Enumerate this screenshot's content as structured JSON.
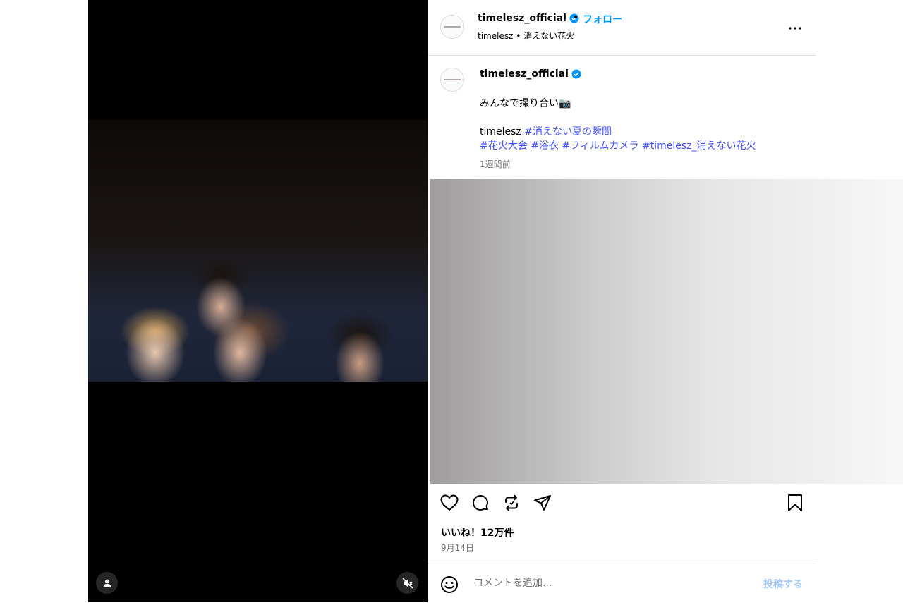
{
  "post": {
    "username": "timelesz_official",
    "follow_label": "フォロー",
    "separator": "•",
    "subline": "timelesz • 消えない花火"
  },
  "caption": {
    "username": "timelesz_official",
    "line1": "みんなで撮り合い📷",
    "author_tag": "timelesz",
    "tag1": "#消えない夏の瞬間",
    "tag2": "#花火大会",
    "tag3": "#浴衣",
    "tag4": "#フィルムカメラ",
    "tag5": "#timelesz_消えない花火",
    "time_ago": "1週間前"
  },
  "engagement": {
    "likes": "いいね！12万件",
    "date": "9月14日"
  },
  "comment": {
    "placeholder": "コメントを追加...",
    "post_label": "投稿する"
  },
  "icons": {
    "verified": "verified-badge-icon",
    "more": "more-options-icon",
    "like": "heart-icon",
    "comment": "comment-icon",
    "repost": "repost-icon",
    "share": "send-icon",
    "save": "bookmark-icon",
    "emoji": "emoji-icon",
    "user_tag": "user-tag-icon",
    "mute": "muted-speaker-icon"
  },
  "colors": {
    "accent": "#0095f6",
    "hashtag": "#4150f7",
    "muted_text": "#737373"
  }
}
